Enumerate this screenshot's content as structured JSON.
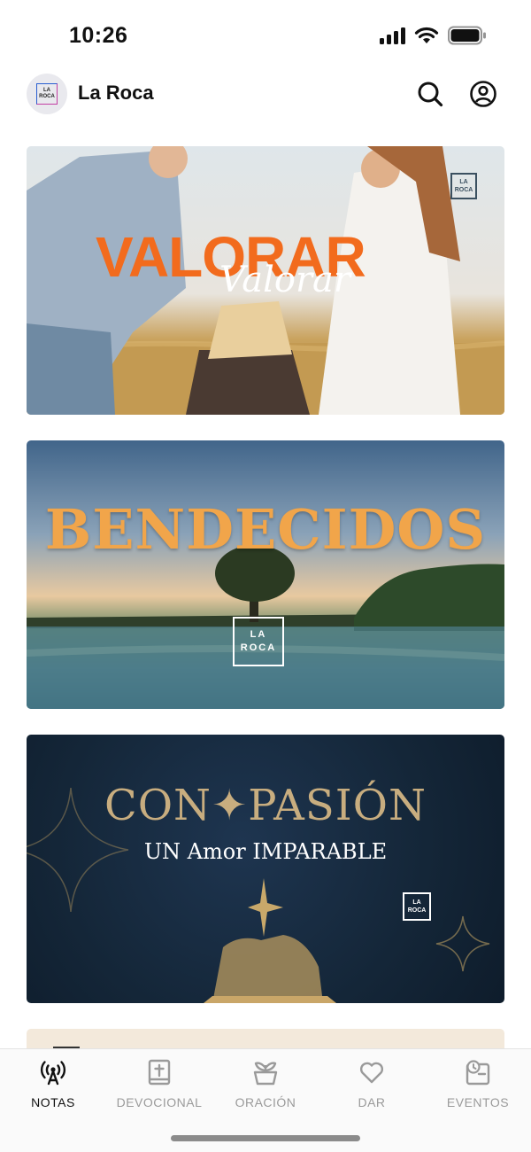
{
  "status_bar": {
    "time": "10:26"
  },
  "header": {
    "title": "La Roca",
    "logo_text_top": "LA",
    "logo_text_bottom": "ROCA"
  },
  "cards": [
    {
      "title": "VALORAR",
      "subtitle": "Valorar",
      "brand_top": "LA",
      "brand_bottom": "ROCA"
    },
    {
      "title": "BENDECIDOS",
      "brand_top": "LA",
      "brand_bottom": "ROCA"
    },
    {
      "title": "CON✦PASIÓN",
      "subtitle": "UN Amor IMPARABLE",
      "brand_top": "LA",
      "brand_bottom": "ROCA"
    }
  ],
  "tabs": [
    {
      "label": "NOTAS",
      "icon": "broadcast-icon",
      "active": true
    },
    {
      "label": "DEVOCIONAL",
      "icon": "bible-icon",
      "active": false
    },
    {
      "label": "ORACIÓN",
      "icon": "praying-hands-icon",
      "active": false
    },
    {
      "label": "DAR",
      "icon": "heart-icon",
      "active": false
    },
    {
      "label": "EVENTOS",
      "icon": "calendar-icon",
      "active": false
    }
  ],
  "colors": {
    "active_tab": "#111111",
    "inactive_tab": "#9a9a9a",
    "accent_orange": "#f26b1d",
    "gold": "#f1a54a"
  }
}
